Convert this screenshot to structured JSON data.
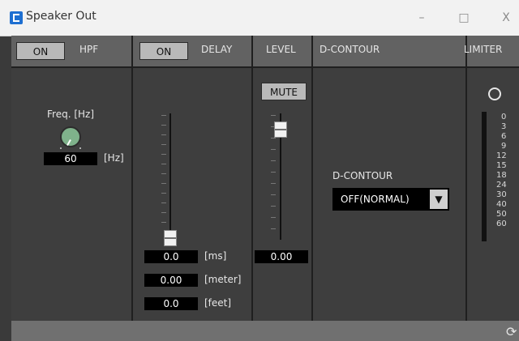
{
  "window": {
    "title": "Speaker Out",
    "minimize": "–",
    "maximize": "□",
    "close": "X"
  },
  "panels": {
    "hpf": {
      "on_label": "ON",
      "title": "HPF",
      "freq_label": "Freq. [Hz]",
      "freq_value": "60",
      "unit": "[Hz]"
    },
    "delay": {
      "on_label": "ON",
      "title": "DELAY",
      "ms_value": "0.0",
      "ms_unit": "[ms]",
      "meter_value": "0.00",
      "meter_unit": "[meter]",
      "feet_value": "0.0",
      "feet_unit": "[feet]"
    },
    "level": {
      "title": "LEVEL",
      "mute_label": "MUTE",
      "value": "0.00"
    },
    "dcontour": {
      "title": "D-CONTOUR",
      "label": "D-CONTOUR",
      "value": "OFF(NORMAL)",
      "arrow": "▼"
    },
    "limiter": {
      "title": "LIMITER",
      "scale": [
        "0",
        "3",
        "6",
        "9",
        "12",
        "15",
        "18",
        "24",
        "30",
        "40",
        "50",
        "60"
      ]
    }
  },
  "footer": {
    "refresh_icon": "⟳"
  }
}
